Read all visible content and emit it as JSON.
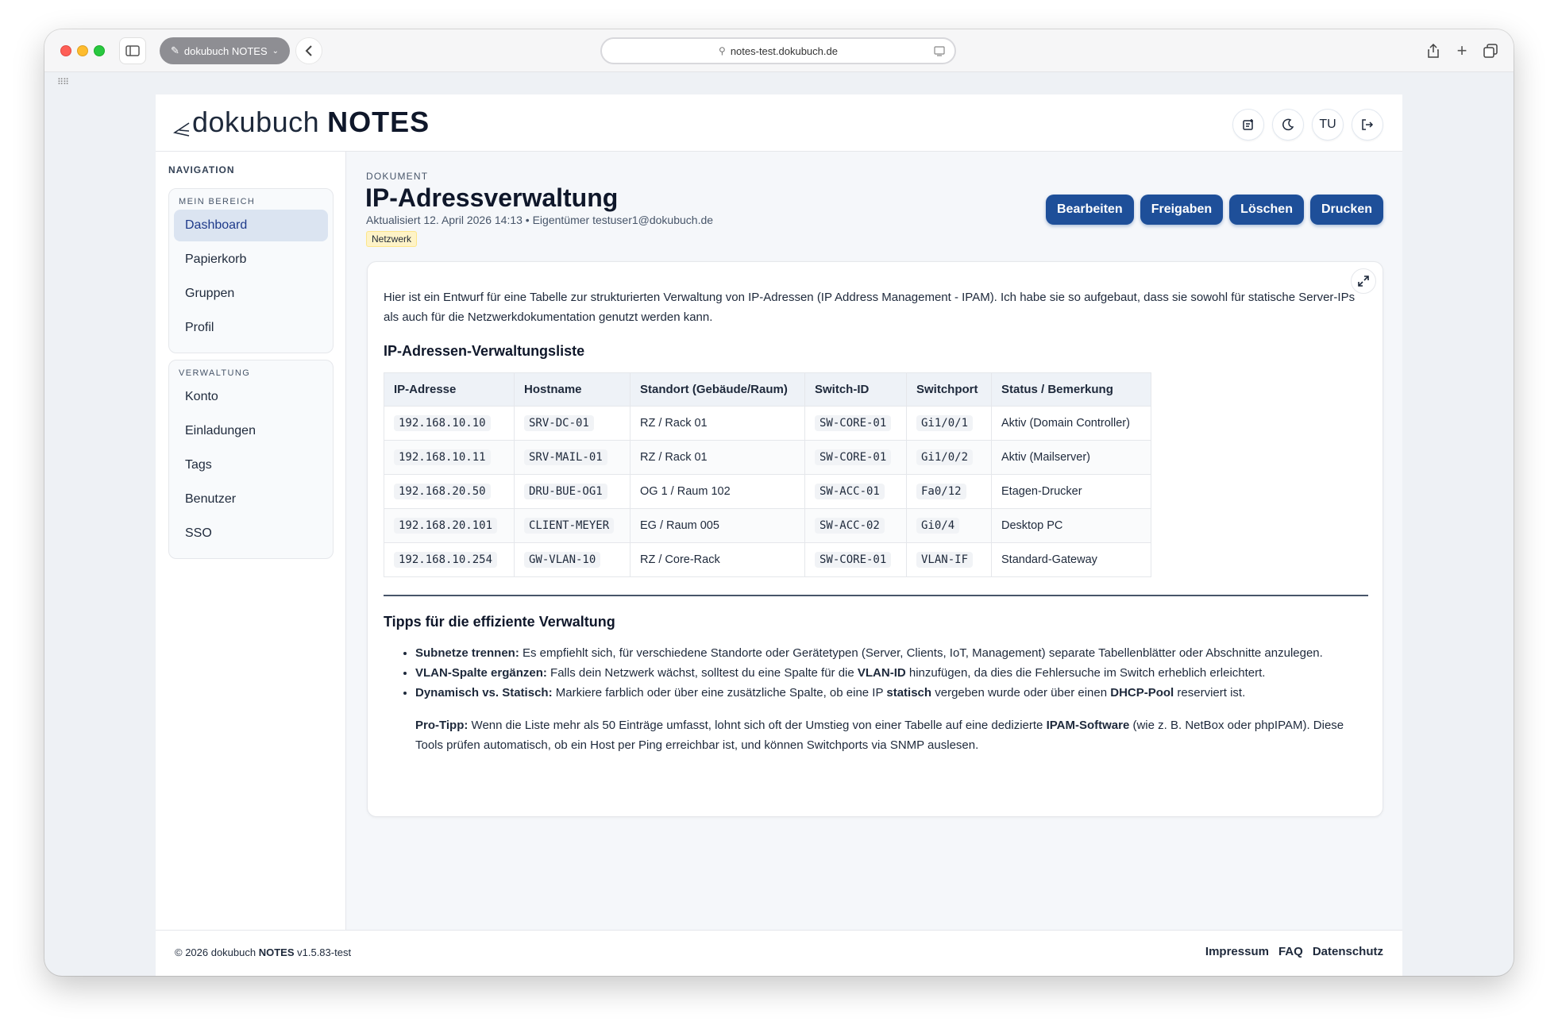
{
  "browser": {
    "tab_group_label": "dokubuch NOTES",
    "url": "notes-test.dokubuch.de"
  },
  "brand": {
    "logo_word": "dokubuch",
    "logo_suffix": "NOTES",
    "accent": "#1e4f99"
  },
  "header": {
    "user_initials": "TU"
  },
  "nav": {
    "title": "NAVIGATION",
    "sections": [
      {
        "title": "MEIN BEREICH",
        "items": [
          "Dashboard",
          "Papierkorb",
          "Gruppen",
          "Profil"
        ]
      },
      {
        "title": "VERWALTUNG",
        "items": [
          "Konto",
          "Einladungen",
          "Tags",
          "Benutzer",
          "SSO"
        ]
      }
    ]
  },
  "doc": {
    "label": "DOKUMENT",
    "title": "IP-Adressverwaltung",
    "meta": "Aktualisiert 12. April 2026 14:13 • Eigentümer testuser1@dokubuch.de",
    "tag": "Netzwerk",
    "actions": [
      "Bearbeiten",
      "Freigaben",
      "Löschen",
      "Drucken"
    ]
  },
  "content": {
    "intro": "Hier ist ein Entwurf für eine Tabelle zur strukturierten Verwaltung von IP-Adressen (IP Address Management - IPAM). Ich habe sie so aufgebaut, dass sie sowohl für statische Server-IPs als auch für die Netzwerkdokumentation genutzt werden kann.",
    "table_heading": "IP-Adressen-Verwaltungsliste",
    "table": {
      "headers": [
        "IP-Adresse",
        "Hostname",
        "Standort (Gebäude/Raum)",
        "Switch-ID",
        "Switchport",
        "Status / Bemerkung"
      ],
      "rows": [
        [
          "192.168.10.10",
          "SRV-DC-01",
          "RZ / Rack 01",
          "SW-CORE-01",
          "Gi1/0/1",
          "Aktiv (Domain Controller)"
        ],
        [
          "192.168.10.11",
          "SRV-MAIL-01",
          "RZ / Rack 01",
          "SW-CORE-01",
          "Gi1/0/2",
          "Aktiv (Mailserver)"
        ],
        [
          "192.168.20.50",
          "DRU-BUE-OG1",
          "OG 1 / Raum 102",
          "SW-ACC-01",
          "Fa0/12",
          "Etagen-Drucker"
        ],
        [
          "192.168.20.101",
          "CLIENT-MEYER",
          "EG / Raum 005",
          "SW-ACC-02",
          "Gi0/4",
          "Desktop PC"
        ],
        [
          "192.168.10.254",
          "GW-VLAN-10",
          "RZ / Core-Rack",
          "SW-CORE-01",
          "VLAN-IF",
          "Standard-Gateway"
        ]
      ]
    },
    "tips_heading": "Tipps für die effiziente Verwaltung",
    "tips": [
      {
        "bold": "Subnetze trennen:",
        "text": " Es empfiehlt sich, für verschiedene Standorte oder Gerätetypen (Server, Clients, IoT, Management) separate Tabellenblätter oder Abschnitte anzulegen."
      },
      {
        "bold": "VLAN-Spalte ergänzen:",
        "text_a": " Falls dein Netzwerk wächst, solltest du eine Spalte für die ",
        "bold_b": "VLAN-ID",
        "text_b": " hinzufügen, da dies die Fehlersuche im Switch erheblich erleichtert."
      },
      {
        "bold": "Dynamisch vs. Statisch:",
        "text_a": " Markiere farblich oder über eine zusätzliche Spalte, ob eine IP ",
        "bold_b": "statisch",
        "text_b": " vergeben wurde oder über einen ",
        "bold_c": "DHCP-Pool",
        "text_c": " reserviert ist."
      }
    ],
    "protip": {
      "bold": "Pro-Tipp:",
      "text_a": " Wenn die Liste mehr als 50 Einträge umfasst, lohnt sich oft der Umstieg von einer Tabelle auf eine dedizierte ",
      "bold_b": "IPAM-Software",
      "text_b": " (wie z. B. NetBox oder phpIPAM). Diese Tools prüfen automatisch, ob ein Host per Ping erreichbar ist, und können Switchports via SNMP auslesen."
    }
  },
  "footer": {
    "copyright_a": "© 2026 dokubuch ",
    "copyright_b": "NOTES",
    "copyright_c": " v1.5.83-test",
    "links": [
      "Impressum",
      "FAQ",
      "Datenschutz"
    ]
  }
}
